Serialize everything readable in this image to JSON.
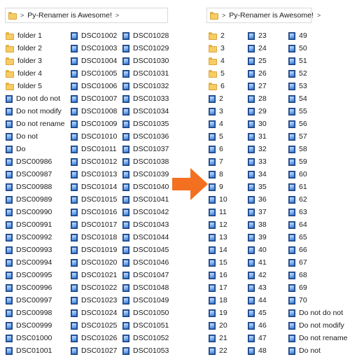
{
  "colors": {
    "arrow": "#f37021",
    "folder": "#f6cd62",
    "image_icon": "#2a5fad"
  },
  "left_window": {
    "breadcrumb": {
      "sep1": ">",
      "title": "Py-Renamer is Awesome!",
      "sep2": ">"
    },
    "columns": [
      [
        {
          "icon": "folder",
          "label": "folder 1"
        },
        {
          "icon": "folder",
          "label": "folder 2"
        },
        {
          "icon": "folder",
          "label": "folder 3"
        },
        {
          "icon": "folder",
          "label": "folder 4"
        },
        {
          "icon": "folder",
          "label": "folder 5"
        },
        {
          "icon": "image",
          "label": "Do not do not"
        },
        {
          "icon": "image",
          "label": "Do not modify"
        },
        {
          "icon": "image",
          "label": "Do not rename"
        },
        {
          "icon": "image",
          "label": "Do not"
        },
        {
          "icon": "image",
          "label": "Do"
        },
        {
          "icon": "image",
          "label": "DSC00986"
        },
        {
          "icon": "image",
          "label": "DSC00987"
        },
        {
          "icon": "image",
          "label": "DSC00988"
        },
        {
          "icon": "image",
          "label": "DSC00989"
        },
        {
          "icon": "image",
          "label": "DSC00990"
        },
        {
          "icon": "image",
          "label": "DSC00991"
        },
        {
          "icon": "image",
          "label": "DSC00992"
        },
        {
          "icon": "image",
          "label": "DSC00993"
        },
        {
          "icon": "image",
          "label": "DSC00994"
        },
        {
          "icon": "image",
          "label": "DSC00995"
        },
        {
          "icon": "image",
          "label": "DSC00996"
        },
        {
          "icon": "image",
          "label": "DSC00997"
        },
        {
          "icon": "image",
          "label": "DSC00998"
        },
        {
          "icon": "image",
          "label": "DSC00999"
        },
        {
          "icon": "image",
          "label": "DSC01000"
        },
        {
          "icon": "image",
          "label": "DSC01001"
        }
      ],
      [
        {
          "icon": "image",
          "label": "DSC01002"
        },
        {
          "icon": "image",
          "label": "DSC01003"
        },
        {
          "icon": "image",
          "label": "DSC01004"
        },
        {
          "icon": "image",
          "label": "DSC01005"
        },
        {
          "icon": "image",
          "label": "DSC01006"
        },
        {
          "icon": "image",
          "label": "DSC01007"
        },
        {
          "icon": "image",
          "label": "DSC01008"
        },
        {
          "icon": "image",
          "label": "DSC01009"
        },
        {
          "icon": "image",
          "label": "DSC01010"
        },
        {
          "icon": "image",
          "label": "DSC01011"
        },
        {
          "icon": "image",
          "label": "DSC01012"
        },
        {
          "icon": "image",
          "label": "DSC01013"
        },
        {
          "icon": "image",
          "label": "DSC01014"
        },
        {
          "icon": "image",
          "label": "DSC01015"
        },
        {
          "icon": "image",
          "label": "DSC01016"
        },
        {
          "icon": "image",
          "label": "DSC01017"
        },
        {
          "icon": "image",
          "label": "DSC01018"
        },
        {
          "icon": "image",
          "label": "DSC01019"
        },
        {
          "icon": "image",
          "label": "DSC01020"
        },
        {
          "icon": "image",
          "label": "DSC01021"
        },
        {
          "icon": "image",
          "label": "DSC01022"
        },
        {
          "icon": "image",
          "label": "DSC01023"
        },
        {
          "icon": "image",
          "label": "DSC01024"
        },
        {
          "icon": "image",
          "label": "DSC01025"
        },
        {
          "icon": "image",
          "label": "DSC01026"
        },
        {
          "icon": "image",
          "label": "DSC01027"
        }
      ],
      [
        {
          "icon": "image",
          "label": "DSC01028"
        },
        {
          "icon": "image",
          "label": "DSC01029"
        },
        {
          "icon": "image",
          "label": "DSC01030"
        },
        {
          "icon": "image",
          "label": "DSC01031"
        },
        {
          "icon": "image",
          "label": "DSC01032"
        },
        {
          "icon": "image",
          "label": "DSC01033"
        },
        {
          "icon": "image",
          "label": "DSC01034"
        },
        {
          "icon": "image",
          "label": "DSC01035"
        },
        {
          "icon": "image",
          "label": "DSC01036"
        },
        {
          "icon": "image",
          "label": "DSC01037"
        },
        {
          "icon": "image",
          "label": "DSC01038"
        },
        {
          "icon": "image",
          "label": "DSC01039"
        },
        {
          "icon": "image",
          "label": "DSC01040"
        },
        {
          "icon": "image",
          "label": "DSC01041"
        },
        {
          "icon": "image",
          "label": "DSC01042"
        },
        {
          "icon": "image",
          "label": "DSC01043"
        },
        {
          "icon": "image",
          "label": "DSC01044"
        },
        {
          "icon": "image",
          "label": "DSC01045"
        },
        {
          "icon": "image",
          "label": "DSC01046"
        },
        {
          "icon": "image",
          "label": "DSC01047"
        },
        {
          "icon": "image",
          "label": "DSC01048"
        },
        {
          "icon": "image",
          "label": "DSC01049"
        },
        {
          "icon": "image",
          "label": "DSC01050"
        },
        {
          "icon": "image",
          "label": "DSC01051"
        },
        {
          "icon": "image",
          "label": "DSC01052"
        },
        {
          "icon": "image",
          "label": "DSC01053"
        }
      ]
    ]
  },
  "right_window": {
    "breadcrumb": {
      "sep1": ">",
      "title": "Py-Renamer is Awesome!",
      "sep2": ">"
    },
    "columns": [
      [
        {
          "icon": "folder",
          "label": "2"
        },
        {
          "icon": "folder",
          "label": "3"
        },
        {
          "icon": "folder",
          "label": "4"
        },
        {
          "icon": "folder",
          "label": "5"
        },
        {
          "icon": "folder",
          "label": "6"
        },
        {
          "icon": "image",
          "label": "2"
        },
        {
          "icon": "image",
          "label": "3"
        },
        {
          "icon": "image",
          "label": "4"
        },
        {
          "icon": "image",
          "label": "5"
        },
        {
          "icon": "image",
          "label": "6"
        },
        {
          "icon": "image",
          "label": "7"
        },
        {
          "icon": "image",
          "label": "8"
        },
        {
          "icon": "image",
          "label": "9"
        },
        {
          "icon": "image",
          "label": "10"
        },
        {
          "icon": "image",
          "label": "11"
        },
        {
          "icon": "image",
          "label": "12"
        },
        {
          "icon": "image",
          "label": "13"
        },
        {
          "icon": "image",
          "label": "14"
        },
        {
          "icon": "image",
          "label": "15"
        },
        {
          "icon": "image",
          "label": "16"
        },
        {
          "icon": "image",
          "label": "17"
        },
        {
          "icon": "image",
          "label": "18"
        },
        {
          "icon": "image",
          "label": "19"
        },
        {
          "icon": "image",
          "label": "20"
        },
        {
          "icon": "image",
          "label": "21"
        },
        {
          "icon": "image",
          "label": "22"
        }
      ],
      [
        {
          "icon": "image",
          "label": "23"
        },
        {
          "icon": "image",
          "label": "24"
        },
        {
          "icon": "image",
          "label": "25"
        },
        {
          "icon": "image",
          "label": "26"
        },
        {
          "icon": "image",
          "label": "27"
        },
        {
          "icon": "image",
          "label": "28"
        },
        {
          "icon": "image",
          "label": "29"
        },
        {
          "icon": "image",
          "label": "30"
        },
        {
          "icon": "image",
          "label": "31"
        },
        {
          "icon": "image",
          "label": "32"
        },
        {
          "icon": "image",
          "label": "33"
        },
        {
          "icon": "image",
          "label": "34"
        },
        {
          "icon": "image",
          "label": "35"
        },
        {
          "icon": "image",
          "label": "36"
        },
        {
          "icon": "image",
          "label": "37"
        },
        {
          "icon": "image",
          "label": "38"
        },
        {
          "icon": "image",
          "label": "39"
        },
        {
          "icon": "image",
          "label": "40"
        },
        {
          "icon": "image",
          "label": "41"
        },
        {
          "icon": "image",
          "label": "42"
        },
        {
          "icon": "image",
          "label": "43"
        },
        {
          "icon": "image",
          "label": "44"
        },
        {
          "icon": "image",
          "label": "45"
        },
        {
          "icon": "image",
          "label": "46"
        },
        {
          "icon": "image",
          "label": "47"
        },
        {
          "icon": "image",
          "label": "48"
        }
      ],
      [
        {
          "icon": "image",
          "label": "49"
        },
        {
          "icon": "image",
          "label": "50"
        },
        {
          "icon": "image",
          "label": "51"
        },
        {
          "icon": "image",
          "label": "52"
        },
        {
          "icon": "image",
          "label": "53"
        },
        {
          "icon": "image",
          "label": "54"
        },
        {
          "icon": "image",
          "label": "55"
        },
        {
          "icon": "image",
          "label": "56"
        },
        {
          "icon": "image",
          "label": "57"
        },
        {
          "icon": "image",
          "label": "58"
        },
        {
          "icon": "image",
          "label": "59"
        },
        {
          "icon": "image",
          "label": "60"
        },
        {
          "icon": "image",
          "label": "61"
        },
        {
          "icon": "image",
          "label": "62"
        },
        {
          "icon": "image",
          "label": "63"
        },
        {
          "icon": "image",
          "label": "64"
        },
        {
          "icon": "image",
          "label": "65"
        },
        {
          "icon": "image",
          "label": "66"
        },
        {
          "icon": "image",
          "label": "67"
        },
        {
          "icon": "image",
          "label": "68"
        },
        {
          "icon": "image",
          "label": "69"
        },
        {
          "icon": "image",
          "label": "70"
        },
        {
          "icon": "image",
          "label": "Do not do not"
        },
        {
          "icon": "image",
          "label": "Do not modify"
        },
        {
          "icon": "image",
          "label": "Do not rename"
        },
        {
          "icon": "image",
          "label": "Do not"
        }
      ]
    ]
  }
}
